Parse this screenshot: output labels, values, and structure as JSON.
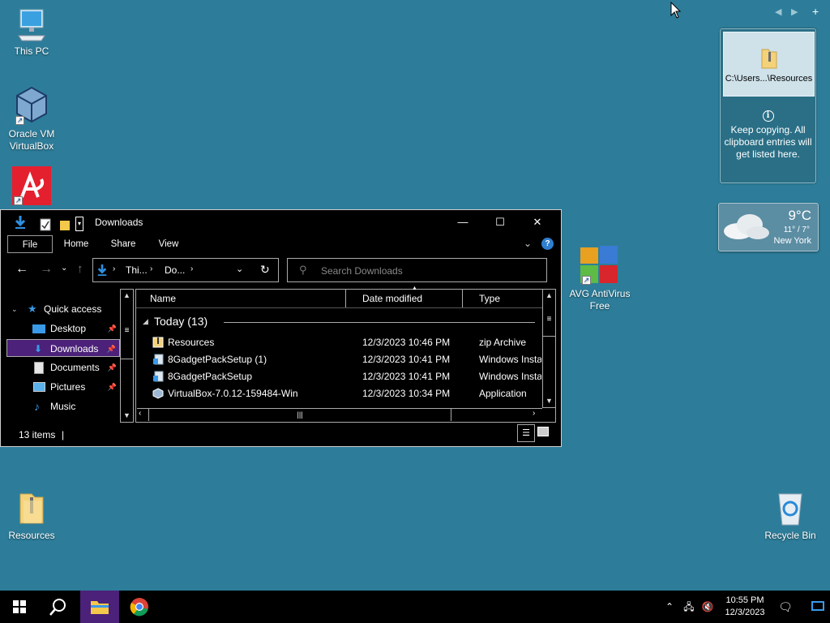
{
  "desktop": {
    "icons": [
      {
        "label": "This PC"
      },
      {
        "label": "Oracle VM VirtualBox"
      },
      {
        "label": "AVG AntiVirus Free"
      },
      {
        "label": "Resources"
      },
      {
        "label": "Recycle Bin"
      }
    ]
  },
  "clipboard_gadget": {
    "item_label": "C:\\Users...\\Resources",
    "note": "Keep copying. All clipboard entries will get listed here.",
    "info_glyph": "i"
  },
  "weather_gadget": {
    "temperature": "9°C",
    "range": "11° / 7°",
    "city": "New York"
  },
  "explorer": {
    "title": "Downloads",
    "ribbon_tabs": [
      "File",
      "Home",
      "Share",
      "View"
    ],
    "address_crumbs": [
      "Thi...",
      "Do..."
    ],
    "search_placeholder": "Search Downloads",
    "nav": {
      "quick_access": "Quick access",
      "items": [
        "Desktop",
        "Downloads",
        "Documents",
        "Pictures",
        "Music"
      ],
      "selected": "Downloads"
    },
    "columns": [
      "Name",
      "Date modified",
      "Type"
    ],
    "group_header": "Today (13)",
    "files": [
      {
        "name": "Resources",
        "date": "12/3/2023 10:46 PM",
        "type": "zip Archive",
        "icon": "zip-icon"
      },
      {
        "name": "8GadgetPackSetup (1)",
        "date": "12/3/2023 10:41 PM",
        "type": "Windows Insta",
        "icon": "installer-icon"
      },
      {
        "name": "8GadgetPackSetup",
        "date": "12/3/2023 10:41 PM",
        "type": "Windows Insta",
        "icon": "installer-icon"
      },
      {
        "name": "VirtualBox-7.0.12-159484-Win",
        "date": "12/3/2023 10:34 PM",
        "type": "Application",
        "icon": "virtualbox-icon"
      }
    ],
    "status": "13 items"
  },
  "taskbar": {
    "time": "10:55 PM",
    "date": "12/3/2023"
  },
  "colors": {
    "desktop_bg": "#2d7d9a",
    "selection": "#4b2179",
    "window_bg": "#000000"
  }
}
